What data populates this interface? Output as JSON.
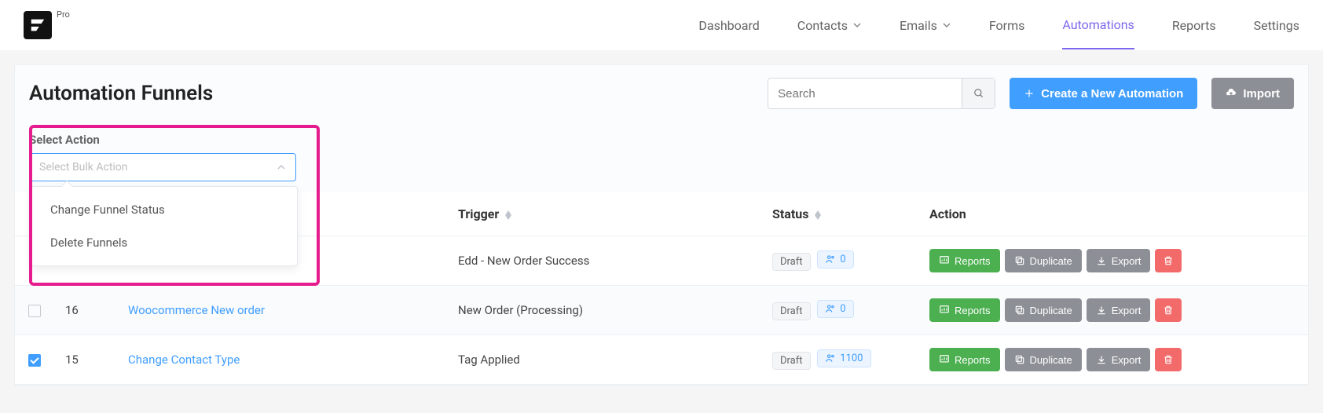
{
  "brand": {
    "badge": "Pro"
  },
  "nav": {
    "items": [
      {
        "label": "Dashboard",
        "chevron": false
      },
      {
        "label": "Contacts",
        "chevron": true
      },
      {
        "label": "Emails",
        "chevron": true
      },
      {
        "label": "Forms",
        "chevron": false
      },
      {
        "label": "Automations",
        "chevron": false,
        "active": true
      },
      {
        "label": "Reports",
        "chevron": false
      },
      {
        "label": "Settings",
        "chevron": false
      }
    ]
  },
  "page": {
    "title": "Automation Funnels"
  },
  "search": {
    "placeholder": "Search"
  },
  "buttons": {
    "create": "Create a New Automation",
    "import": "Import"
  },
  "bulk": {
    "label": "Select Action",
    "placeholder": "Select Bulk Action",
    "options": [
      "Change Funnel Status",
      "Delete Funnels"
    ]
  },
  "columns": {
    "trigger": "Trigger",
    "status": "Status",
    "action": "Action"
  },
  "actions": {
    "reports": "Reports",
    "duplicate": "Duplicate",
    "export": "Export"
  },
  "rows": [
    {
      "id": "",
      "title": "",
      "trigger": "Edd - New Order Success",
      "status": "Draft",
      "count": "0",
      "checked": false
    },
    {
      "id": "16",
      "title": "Woocommerce New order",
      "trigger": "New Order (Processing)",
      "status": "Draft",
      "count": "0",
      "checked": false
    },
    {
      "id": "15",
      "title": "Change Contact Type",
      "trigger": "Tag Applied",
      "status": "Draft",
      "count": "1100",
      "checked": true
    }
  ]
}
